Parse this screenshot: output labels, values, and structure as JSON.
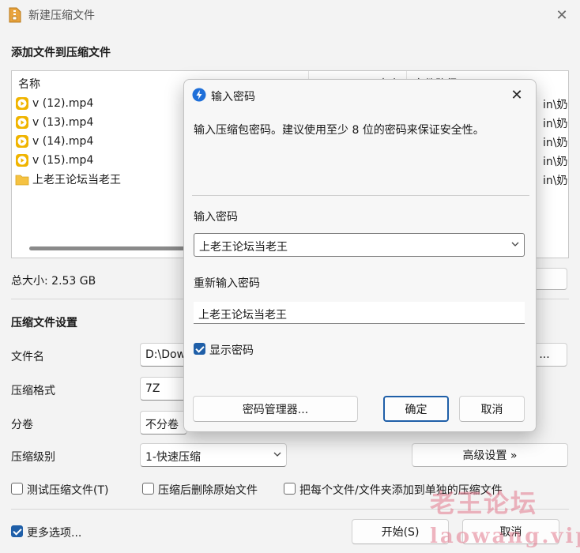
{
  "window": {
    "title": "新建压缩文件",
    "close_glyph": "✕"
  },
  "files_section": {
    "heading": "添加文件到压缩文件",
    "columns": [
      "名称",
      "大小",
      "文件路径"
    ],
    "rows": [
      {
        "name": "v (12).mp4",
        "icon": "video-file-icon",
        "path_fragment": "in\\奶粉"
      },
      {
        "name": "v (13).mp4",
        "icon": "video-file-icon",
        "path_fragment": "in\\奶粉"
      },
      {
        "name": "v (14).mp4",
        "icon": "video-file-icon",
        "path_fragment": "in\\奶粉"
      },
      {
        "name": "v (15).mp4",
        "icon": "video-file-icon",
        "path_fragment": "in\\奶粉"
      },
      {
        "name": "上老王论坛当老王",
        "icon": "folder-icon",
        "path_fragment": "in\\奶粉"
      }
    ],
    "total_size_label": "总大小: 2.53 GB"
  },
  "settings": {
    "heading": "压缩文件设置",
    "filename_label": "文件名",
    "filename_value": "D:\\Dow",
    "browse_label": "...",
    "format_label": "压缩格式",
    "format_value": "7Z",
    "volume_label": "分卷",
    "volume_value": "不分卷",
    "level_label": "压缩级别",
    "level_value": "1-快速压缩",
    "advanced_button": "高级设置 »",
    "test_checkbox": "测试压缩文件(T)",
    "delete_checkbox": "压缩后删除原始文件",
    "separate_checkbox": "把每个文件/文件夹添加到单独的压缩文件",
    "more_options": "更多选项...",
    "start_button": "开始(S)",
    "cancel_button": "取消"
  },
  "watermark": {
    "text_cn": "老王论坛",
    "text_en": "laowang.vip"
  },
  "password_dialog": {
    "title": "输入密码",
    "close_glyph": "✕",
    "description": "输入压缩包密码。建议使用至少 8 位的密码来保证安全性。",
    "password_label": "输入密码",
    "password_value": "上老王论坛当老王",
    "confirm_label": "重新输入密码",
    "confirm_value": "上老王论坛当老王",
    "show_password_label": "显示密码",
    "show_password_checked": true,
    "manager_button": "密码管理器...",
    "ok_button": "确定",
    "cancel_button": "取消"
  },
  "colors": {
    "accent": "#1f5fa8",
    "folder": "#f5c242",
    "video_icon": "#f0b400",
    "watermark": "#e2788c"
  }
}
